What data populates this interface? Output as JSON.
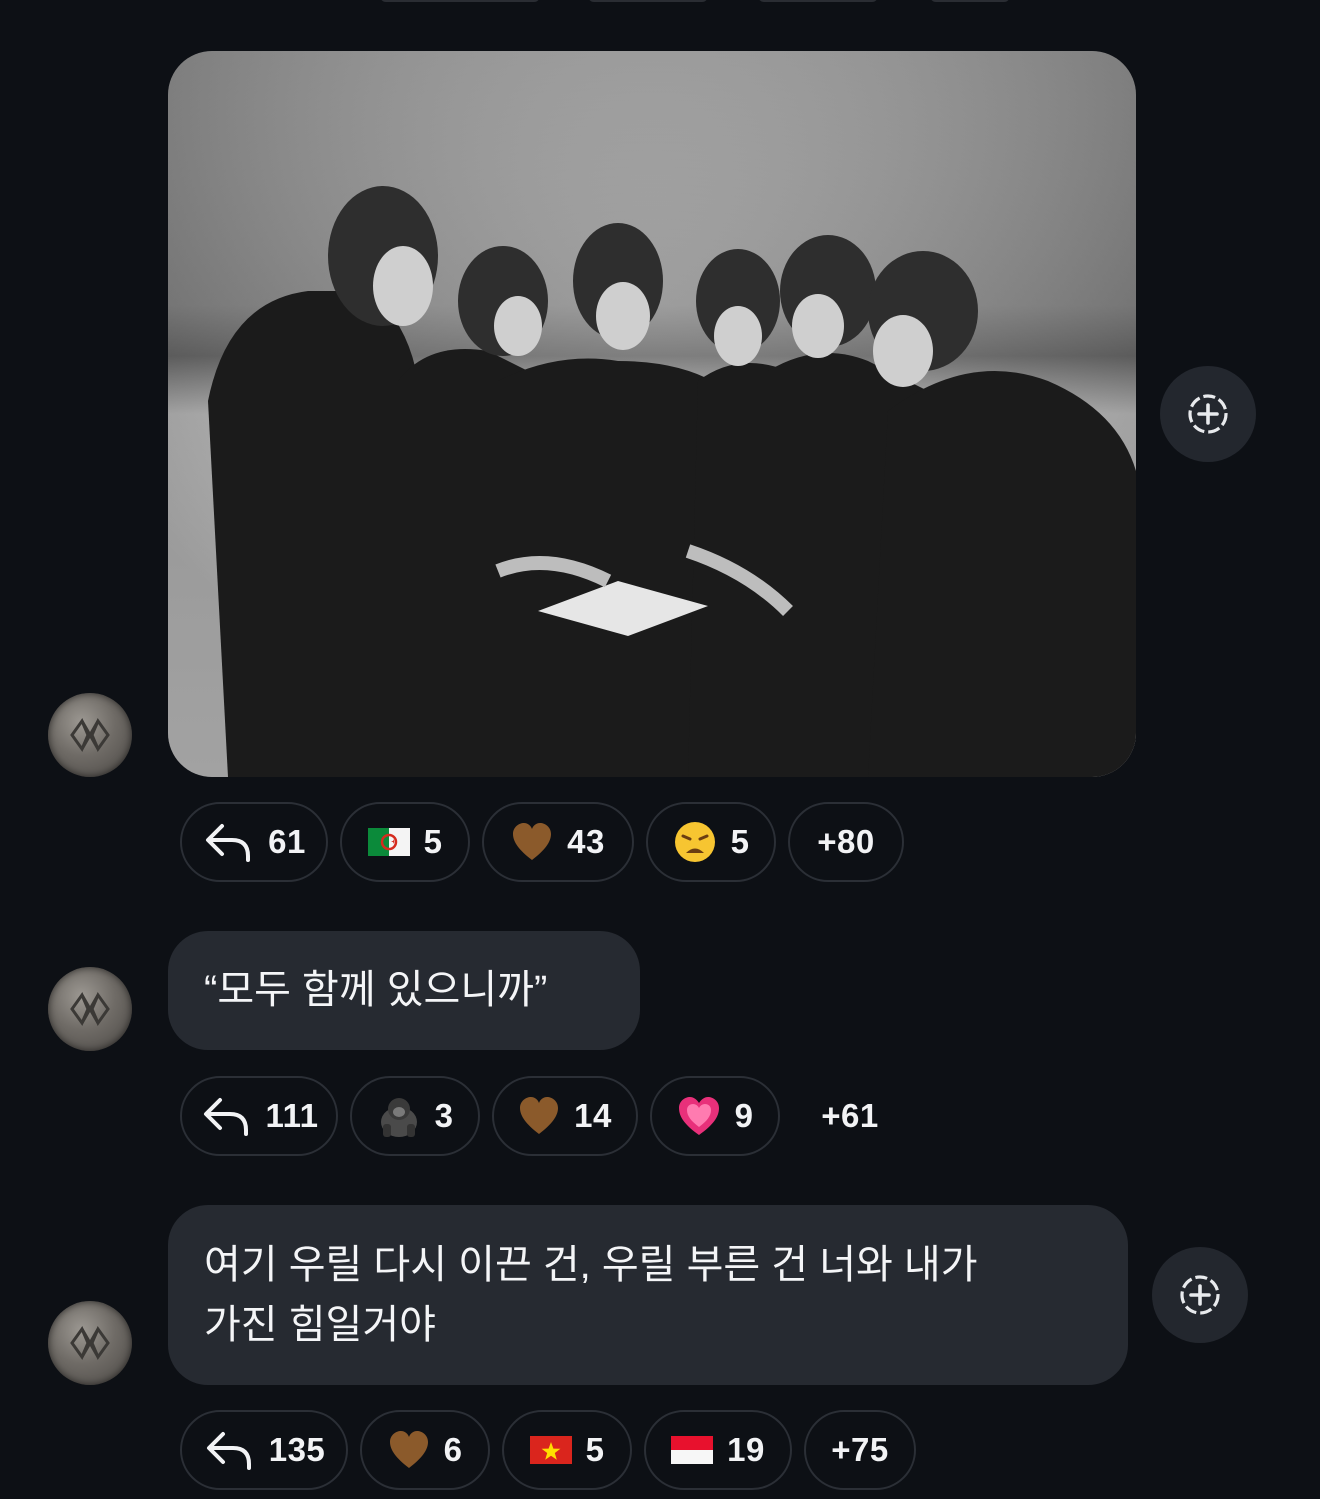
{
  "messages": [
    {
      "type": "image",
      "image_description": "Black and white photo of six men in dark jackets huddled together looking at an open book",
      "reactions": {
        "reply_count": "61",
        "items": [
          {
            "emoji_name": "algeria-flag-icon",
            "count": "5"
          },
          {
            "emoji_name": "brown-heart-icon",
            "count": "43"
          },
          {
            "emoji_name": "weary-face-icon",
            "count": "5"
          }
        ],
        "more": "+80"
      }
    },
    {
      "type": "text",
      "text": "“모두 함께 있으니까”",
      "reactions": {
        "reply_count": "111",
        "items": [
          {
            "emoji_name": "gorilla-icon",
            "count": "3"
          },
          {
            "emoji_name": "brown-heart-icon",
            "count": "14"
          },
          {
            "emoji_name": "growing-heart-icon",
            "count": "9"
          }
        ],
        "more": "+61"
      }
    },
    {
      "type": "text",
      "text_line1": "여기 우릴 다시 이끈 건, 우릴 부른 건 너와 내가",
      "text_line2": "가진 힘일거야",
      "reactions": {
        "reply_count": "135",
        "items": [
          {
            "emoji_name": "brown-heart-icon",
            "count": "6"
          },
          {
            "emoji_name": "vietnam-flag-icon",
            "count": "5"
          },
          {
            "emoji_name": "indonesia-flag-icon",
            "count": "19"
          }
        ],
        "more": "+75"
      }
    }
  ],
  "colors": {
    "background": "#0d1015",
    "bubble": "#262a31",
    "pill_border": "#2b2f36",
    "text": "#f2f3f5"
  }
}
